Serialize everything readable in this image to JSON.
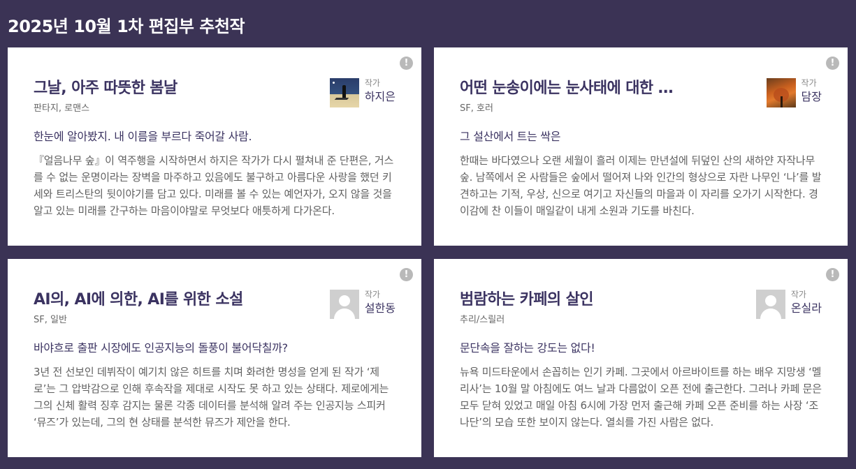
{
  "header": {
    "title": "2025년 10월 1차 편집부 추천작"
  },
  "cards": [
    {
      "title": "그날, 아주 따뜻한 봄날",
      "genre": "판타지, 로맨스",
      "author_role": "작가",
      "author_name": "하지은",
      "tagline": "한눈에 알아봤지. 내 이름을 부르다 죽어갈 사람.",
      "description": "『얼음나무 숲』이 역주행을 시작하면서 하지은 작가가 다시 펼쳐내 준 단편은, 거스를 수 없는 운명이라는 장벽을 마주하고 있음에도 불구하고 아름다운 사랑을 했던 키세와 트리스탄의 뒷이야기를 담고 있다. 미래를 볼 수 있는 예언자가, 오지 않을 것을 알고 있는 미래를 간구하는 마음이야말로 무엇보다 애틋하게 다가온다.",
      "report_icon": "!"
    },
    {
      "title": "어떤 눈송이에는 눈사태에 대한 책임이 있다",
      "genre": "SF, 호러",
      "author_role": "작가",
      "author_name": "담장",
      "tagline": "그 설산에서 트는 싹은",
      "description": "한때는 바다였으나 오랜 세월이 흘러 이제는 만년설에 뒤덮인 산의 새하얀 자작나무 숲. 남쪽에서 온 사람들은 숲에서 떨어져 나와 인간의 형상으로 자란 나무인 ‘나’를 발견하고는 기적, 우상, 신으로 여기고 자신들의 마을과 이 자리를 오가기 시작한다. 경이감에 찬 이들이 매일같이 내게 소원과 기도를 바친다.",
      "report_icon": "!"
    },
    {
      "title": "AI의, AI에 의한, AI를 위한 소설",
      "genre": "SF, 일반",
      "author_role": "작가",
      "author_name": "설한동",
      "tagline": "바야흐로 출판 시장에도 인공지능의 돌풍이 불어닥칠까?",
      "description": "3년 전 선보인 데뷔작이 예기치 않은 히트를 치며 화려한 명성을 얻게 된 작가 ‘제로’는 그 압박감으로 인해 후속작을 제대로 시작도 못 하고 있는 상태다. 제로에게는 그의 신체 활력 징후 감지는 물론 각종 데이터를 분석해 알려 주는 인공지능 스피커 ‘뮤즈’가 있는데, 그의 현 상태를 분석한 뮤즈가 제안을 한다.",
      "report_icon": "!"
    },
    {
      "title": "범람하는 카페의 살인",
      "genre": "추리/스릴러",
      "author_role": "작가",
      "author_name": "온실라",
      "tagline": "문단속을 잘하는 강도는 없다!",
      "description": "뉴욕 미드타운에서 손꼽히는 인기 카페. 그곳에서 아르바이트를 하는 배우 지망생 ‘멜리사’는 10월 말 아침에도 여느 날과 다름없이 오픈 전에 출근한다. 그러나 카페 문은 모두 닫혀 있었고 매일 아침 6시에 가장 먼저 출근해 카페 오픈 준비를 하는 사장 ‘조나단’의 모습 또한 보이지 않는다. 열쇠를 가진 사람은 없다.",
      "report_icon": "!"
    }
  ]
}
